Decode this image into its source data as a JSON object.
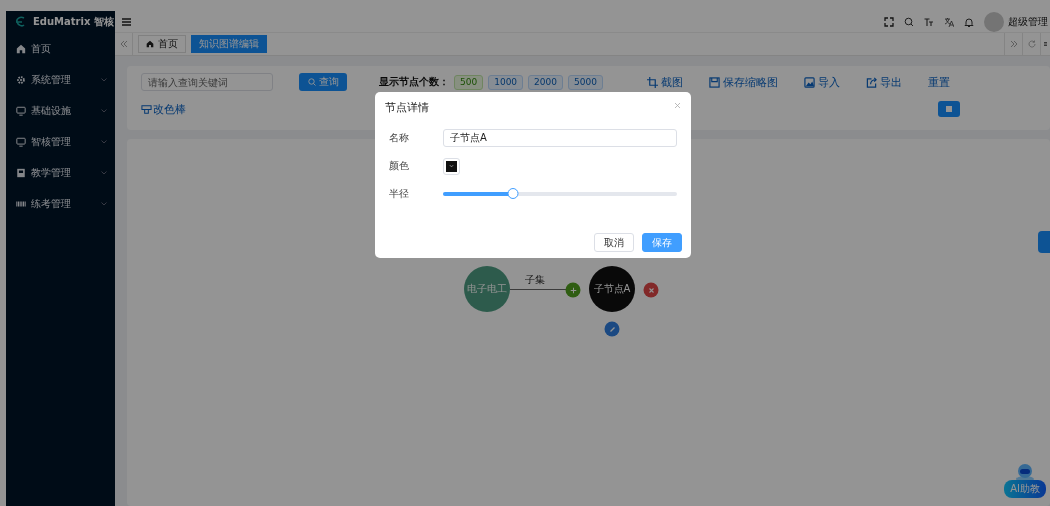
{
  "sidebar": {
    "brand": "EduMatrix 智核",
    "items": [
      {
        "label": "首页",
        "has_children": false
      },
      {
        "label": "系统管理",
        "has_children": true
      },
      {
        "label": "基础设施",
        "has_children": true
      },
      {
        "label": "智核管理",
        "has_children": true
      },
      {
        "label": "教学管理",
        "has_children": true
      },
      {
        "label": "练考管理",
        "has_children": true
      }
    ]
  },
  "header": {
    "user": "超级管理"
  },
  "tabs": [
    {
      "label": "首页",
      "selected": false
    },
    {
      "label": "知识图谱编辑",
      "selected": true
    }
  ],
  "toolbar": {
    "search": {
      "placeholder": "请输入查询关键词"
    },
    "search_button": "查询",
    "node_count_label": "显示节点个数：",
    "node_counts": [
      {
        "label": "500",
        "selected": true
      },
      {
        "label": "1000",
        "selected": false
      },
      {
        "label": "2000",
        "selected": false
      },
      {
        "label": "5000",
        "selected": false
      }
    ],
    "actions": [
      {
        "label": "截图"
      },
      {
        "label": "保存缩略图"
      },
      {
        "label": "导入"
      },
      {
        "label": "导出"
      },
      {
        "label": "重置"
      }
    ],
    "recolor": "改色棒"
  },
  "graph": {
    "nodes": [
      {
        "label": "电子电工"
      },
      {
        "label": "子节点A"
      }
    ],
    "edge_label": "子集"
  },
  "dialog": {
    "title": "节点详情",
    "name_label": "名称",
    "name_value": "子节点A",
    "color_label": "颜色",
    "radius_label": "半径",
    "radius": {
      "level": 0.3
    },
    "buttons": [
      {
        "label": "取消",
        "kind": "default"
      },
      {
        "label": "保存",
        "kind": "primary"
      }
    ]
  },
  "assistant": {
    "label": "AI助教"
  }
}
